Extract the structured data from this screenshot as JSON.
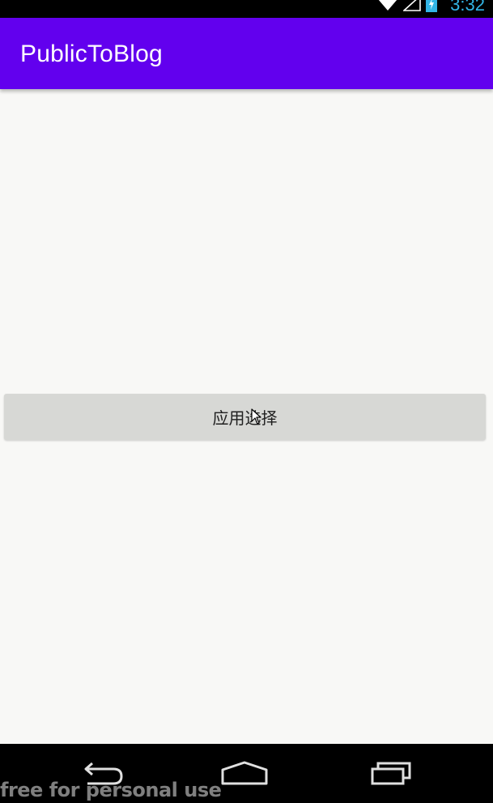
{
  "status_bar": {
    "time": "3:32",
    "icons": [
      "wifi-icon",
      "signal-icon",
      "battery-charging-icon"
    ],
    "time_color": "#33b5e5"
  },
  "toolbar": {
    "title": "PublicToBlog",
    "color": "#6200ee"
  },
  "main": {
    "button_label": "应用选择",
    "background": "#f8f8f6"
  },
  "nav_bar": {
    "buttons": [
      "back-icon",
      "home-icon",
      "recents-icon"
    ]
  },
  "watermark": {
    "text": "free for personal use"
  }
}
